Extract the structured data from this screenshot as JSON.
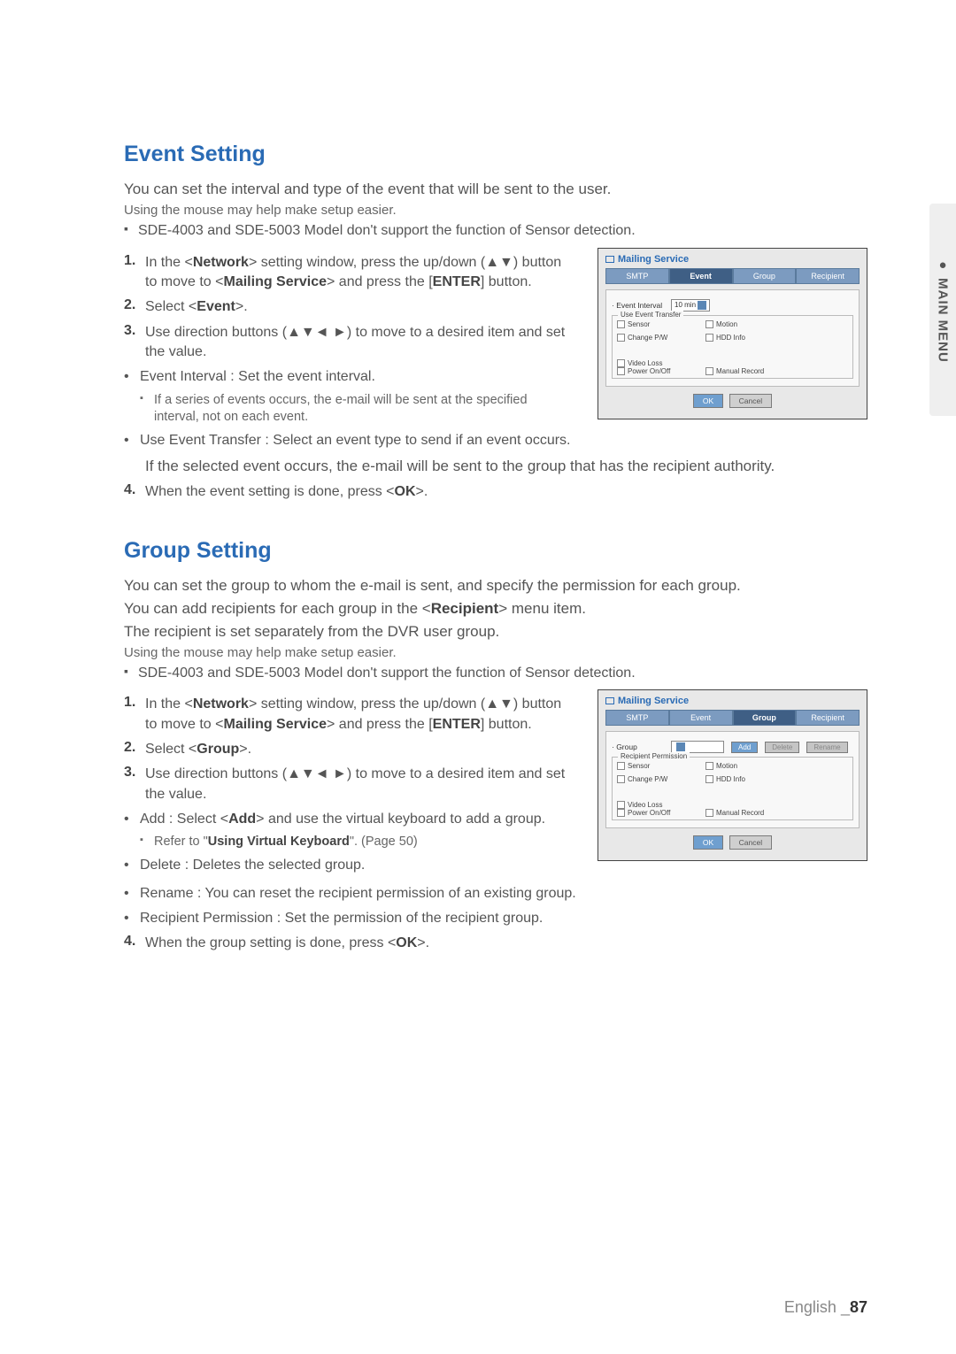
{
  "sideTab": "●  MAIN MENU",
  "sections": {
    "event": {
      "heading": "Event Setting",
      "intro1": "You can set the interval and type of the event that will be sent to the user.",
      "intro2": "Using the mouse may help make setup easier.",
      "note1": "SDE-4003 and SDE-5003 Model don't support the function of Sensor detection.",
      "step1a": "In the <",
      "step1_net": "Network",
      "step1b": "> setting window, press the up/down (▲▼) button to move to <",
      "step1_ms": "Mailing Service",
      "step1c": "> and press the [",
      "step1_enter": "ENTER",
      "step1d": "] button.",
      "step2a": "Select <",
      "step2_ev": "Event",
      "step2b": ">.",
      "step3": "Use direction buttons (▲▼◄ ►) to move to a desired item and set the value.",
      "sub1": "Event Interval : Set the event interval.",
      "sub1note": "If a series of events occurs, the e-mail will be sent at the specified interval, not on each event.",
      "sub2": "Use Event Transfer : Select an event type to send if an event occurs.",
      "sub2detail": "If the selected event occurs, the e-mail will be sent to the group that has the recipient authority.",
      "step4a": "When the event setting is done, press <",
      "step4_ok": "OK",
      "step4b": ">."
    },
    "group": {
      "heading": "Group Setting",
      "intro1": "You can set the group to whom the e-mail is sent, and specify the permission for each group.",
      "intro2a": "You can add recipients for each group in the <",
      "intro2b": "Recipient",
      "intro2c": "> menu item.",
      "intro3": "The recipient is set separately from the DVR user group.",
      "intro4": "Using the mouse may help make setup easier.",
      "note1": "SDE-4003 and SDE-5003 Model don't support the function of Sensor detection.",
      "step1a": "In the <",
      "step1_net": "Network",
      "step1b": "> setting window, press the up/down (▲▼) button to move to <",
      "step1_ms": "Mailing Service",
      "step1c": "> and press the [",
      "step1_enter": "ENTER",
      "step1d": "] button.",
      "step2a": "Select <",
      "step2_gr": "Group",
      "step2b": ">.",
      "step3": "Use direction buttons (▲▼◄ ►) to move to a desired item and set the value.",
      "sub_add_a": "Add : Select <",
      "sub_add_b": "Add",
      "sub_add_c": "> and use the virtual keyboard to add a group.",
      "sub_add_ref_a": "Refer to \"",
      "sub_add_ref_b": "Using Virtual Keyboard",
      "sub_add_ref_c": "\". (Page 50)",
      "sub_del": "Delete : Deletes the selected group.",
      "sub_ren": "Rename : You can reset the recipient permission of an existing group.",
      "sub_perm": "Recipient Permission : Set the permission of the recipient group.",
      "step4a": "When the group setting is done, press <",
      "step4_ok": "OK",
      "step4b": ">."
    }
  },
  "shot_common": {
    "window_title": "Mailing Service",
    "tab_smtp": "SMTP",
    "tab_event": "Event",
    "tab_group": "Group",
    "tab_recipient": "Recipient",
    "ok": "OK",
    "cancel": "Cancel",
    "chk_sensor": "Sensor",
    "chk_motion": "Motion",
    "chk_change": "Change P/W",
    "chk_hdd": "HDD Info",
    "chk_video": "Video Loss",
    "chk_power": "Power On/Off",
    "chk_manual": "Manual Record"
  },
  "shot_event": {
    "lbl_interval": "· Event Interval",
    "val_interval": "10 min",
    "legend": "Use Event Transfer"
  },
  "shot_group": {
    "lbl_group": "· Group",
    "val_group": "",
    "btn_add": "Add",
    "btn_delete": "Delete",
    "btn_rename": "Rename",
    "legend": "Recipient Permission"
  },
  "footer": {
    "lang": "English _",
    "page": "87"
  }
}
